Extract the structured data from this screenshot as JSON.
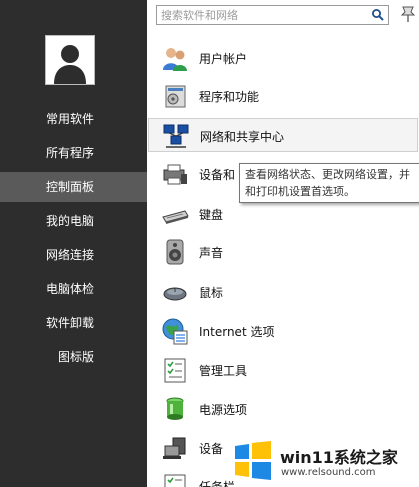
{
  "search": {
    "placeholder": "搜索软件和网络"
  },
  "sidebar": {
    "items": [
      {
        "label": "常用软件"
      },
      {
        "label": "所有程序"
      },
      {
        "label": "控制面板"
      },
      {
        "label": "我的电脑"
      },
      {
        "label": "网络连接"
      },
      {
        "label": "电脑体检"
      },
      {
        "label": "软件卸载"
      },
      {
        "label": "图标版"
      }
    ],
    "selected": "控制面板"
  },
  "panel": {
    "items": [
      {
        "label": "用户帐户",
        "icon": "user-accounts-icon"
      },
      {
        "label": "程序和功能",
        "icon": "programs-features-icon"
      },
      {
        "label": "网络和共享中心",
        "icon": "network-sharing-icon"
      },
      {
        "label": "设备和",
        "icon": "devices-printers-icon"
      },
      {
        "label": "键盘",
        "icon": "keyboard-icon"
      },
      {
        "label": "声音",
        "icon": "sound-icon"
      },
      {
        "label": "鼠标",
        "icon": "mouse-icon"
      },
      {
        "label": "Internet 选项",
        "icon": "internet-options-icon"
      },
      {
        "label": "管理工具",
        "icon": "admin-tools-icon"
      },
      {
        "label": "电源选项",
        "icon": "power-options-icon"
      },
      {
        "label": "设备",
        "icon": "device-manager-icon"
      },
      {
        "label": "任务栏",
        "icon": "taskbar-icon"
      }
    ]
  },
  "tooltip": {
    "line1": "查看网络状态、更改网络设置，并",
    "line2": "和打印机设置首选项。"
  },
  "watermark": {
    "title": "win11系统之家",
    "url": "www.relsound.com"
  },
  "colors": {
    "sidebar": "#2d2d2d",
    "selected": "#5a5a5a",
    "win_blue": "#1e88e5",
    "win_yellow": "#ffc107"
  }
}
